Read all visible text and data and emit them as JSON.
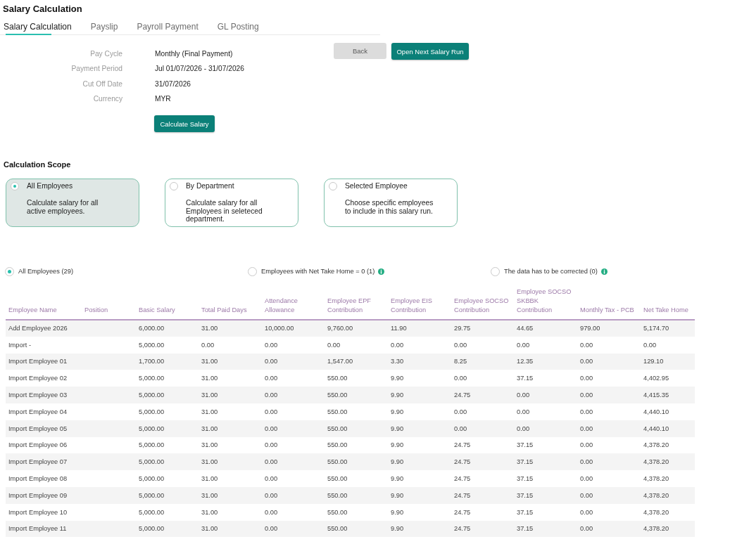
{
  "page_title": "Salary Calculation",
  "tabs": [
    {
      "label": "Salary Calculation",
      "selected": true
    },
    {
      "label": "Payslip",
      "selected": false
    },
    {
      "label": "Payroll Payment",
      "selected": false
    },
    {
      "label": "GL Posting",
      "selected": false
    }
  ],
  "summary": {
    "fields": [
      {
        "label": "Pay Cycle",
        "value": "Monthly (Final Payment)"
      },
      {
        "label": "Payment Period",
        "value": "Jul 01/07/2026 - 31/07/2026"
      },
      {
        "label": "Cut Off Date",
        "value": "31/07/2026"
      },
      {
        "label": "Currency",
        "value": "MYR"
      }
    ],
    "calculate_button": "Calculate Salary"
  },
  "actions": {
    "back_button": "Back",
    "next_run_button": "Open Next Salary Run"
  },
  "calculation_scope": {
    "title": "Calculation Scope",
    "options": [
      {
        "title": "All Employees",
        "description": "Calculate salary for all active employees.",
        "selected": true
      },
      {
        "title": "By Department",
        "description": "Calculate salary for all Employees in seleteced department.",
        "selected": false
      },
      {
        "title": "Selected Employee",
        "description": "Choose specific employees to include in this salary run.",
        "selected": false
      }
    ]
  },
  "filters": [
    {
      "label": "All Employees (29)",
      "selected": true,
      "info_icon": false
    },
    {
      "label": "Employees with Net Take Home = 0 (1)",
      "selected": false,
      "info_icon": true
    },
    {
      "label": "The data has to be corrected (0)",
      "selected": false,
      "info_icon": true
    }
  ],
  "table": {
    "columns": [
      "Employee Name",
      "Position",
      "Basic Salary",
      "Total Paid Days",
      "Attendance Allowance",
      "Employee EPF Contribution",
      "Employee EIS Contribution",
      "Employee SOCSO Contribution",
      "Employee SOCSO SKBBK Contribution",
      "Monthly Tax - PCB",
      "Net Take Home"
    ],
    "rows": [
      {
        "employee_name": "Add Employee 2026",
        "amounts": [
          "6,000.00",
          "31.00",
          "10,000.00",
          "9,760.00",
          "11.90",
          "29.75",
          "44.65",
          "979.00",
          "5,174.70"
        ]
      },
      {
        "employee_name": "Import -",
        "amounts": [
          "5,000.00",
          "0.00",
          "0.00",
          "0.00",
          "0.00",
          "0.00",
          "0.00",
          "0.00",
          "0.00"
        ]
      },
      {
        "employee_name": "Import Employee 01",
        "amounts": [
          "1,700.00",
          "31.00",
          "0.00",
          "1,547.00",
          "3.30",
          "8.25",
          "12.35",
          "0.00",
          "129.10"
        ]
      },
      {
        "employee_name": "Import Employee 02",
        "amounts": [
          "5,000.00",
          "31.00",
          "0.00",
          "550.00",
          "9.90",
          "0.00",
          "37.15",
          "0.00",
          "4,402.95"
        ]
      },
      {
        "employee_name": "Import Employee 03",
        "amounts": [
          "5,000.00",
          "31.00",
          "0.00",
          "550.00",
          "9.90",
          "24.75",
          "0.00",
          "0.00",
          "4,415.35"
        ]
      },
      {
        "employee_name": "Import Employee 04",
        "amounts": [
          "5,000.00",
          "31.00",
          "0.00",
          "550.00",
          "9.90",
          "0.00",
          "0.00",
          "0.00",
          "4,440.10"
        ]
      },
      {
        "employee_name": "Import Employee 05",
        "amounts": [
          "5,000.00",
          "31.00",
          "0.00",
          "550.00",
          "9.90",
          "0.00",
          "0.00",
          "0.00",
          "4,440.10"
        ]
      },
      {
        "employee_name": "Import Employee 06",
        "amounts": [
          "5,000.00",
          "31.00",
          "0.00",
          "550.00",
          "9.90",
          "24.75",
          "37.15",
          "0.00",
          "4,378.20"
        ]
      },
      {
        "employee_name": "Import Employee 07",
        "amounts": [
          "5,000.00",
          "31.00",
          "0.00",
          "550.00",
          "9.90",
          "24.75",
          "37.15",
          "0.00",
          "4,378.20"
        ]
      },
      {
        "employee_name": "Import Employee 08",
        "amounts": [
          "5,000.00",
          "31.00",
          "0.00",
          "550.00",
          "9.90",
          "24.75",
          "37.15",
          "0.00",
          "4,378.20"
        ]
      },
      {
        "employee_name": "Import Employee 09",
        "amounts": [
          "5,000.00",
          "31.00",
          "0.00",
          "550.00",
          "9.90",
          "24.75",
          "37.15",
          "0.00",
          "4,378.20"
        ]
      },
      {
        "employee_name": "Import Employee 10",
        "amounts": [
          "5,000.00",
          "31.00",
          "0.00",
          "550.00",
          "9.90",
          "24.75",
          "37.15",
          "0.00",
          "4,378.20"
        ]
      },
      {
        "employee_name": "Import Employee 11",
        "amounts": [
          "5,000.00",
          "31.00",
          "0.00",
          "550.00",
          "9.90",
          "24.75",
          "37.15",
          "0.00",
          "4,378.20"
        ]
      }
    ]
  }
}
